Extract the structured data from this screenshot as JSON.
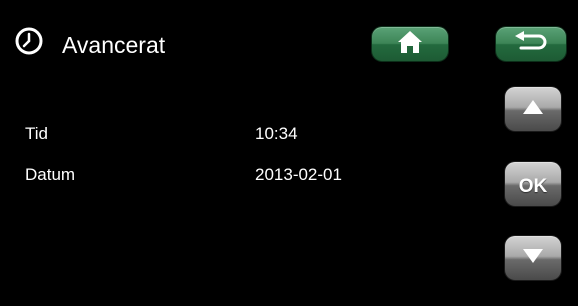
{
  "header": {
    "title": "Avancerat",
    "icon": "clock-icon"
  },
  "navigation": {
    "home_icon": "home-icon",
    "back_icon": "return-arrow-icon"
  },
  "settings": {
    "time": {
      "label": "Tid",
      "value": "10:34"
    },
    "date": {
      "label": "Datum",
      "value": "2013-02-01"
    }
  },
  "side_buttons": {
    "up_icon": "up-arrow-icon",
    "ok_label": "OK",
    "down_icon": "down-arrow-icon"
  },
  "colors": {
    "background": "#000000",
    "text": "#ffffff",
    "nav_button_green": "#2f7a4b",
    "side_button_grey": "#8c8c8c"
  }
}
